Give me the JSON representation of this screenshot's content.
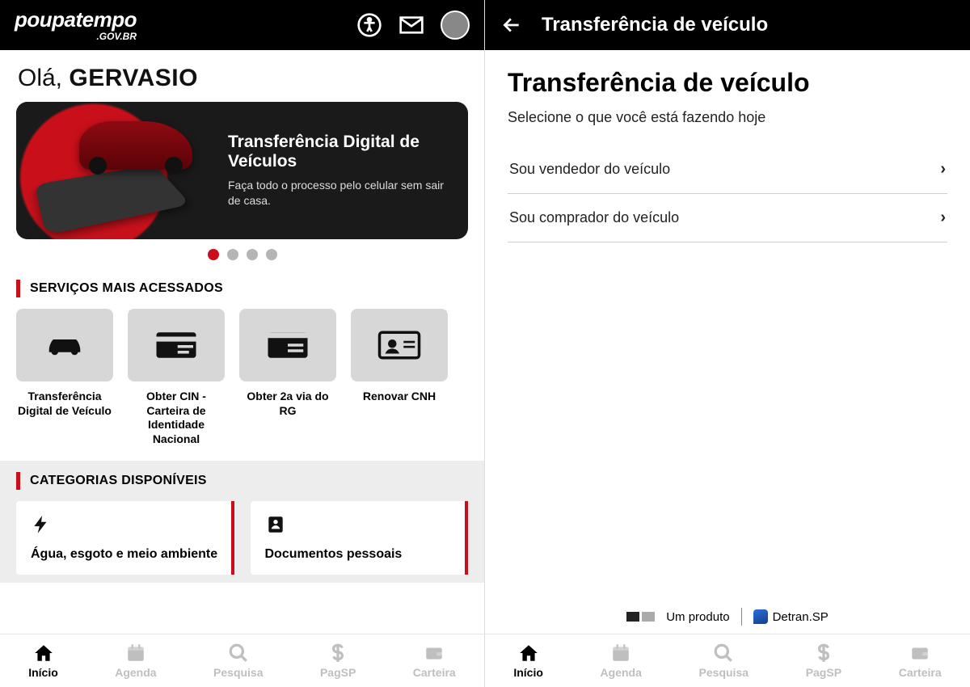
{
  "left": {
    "logo": {
      "main": "poupatempo",
      "sub": ".GOV.BR"
    },
    "greeting_prefix": "Olá, ",
    "user_name": "GERVASIO",
    "promo": {
      "title": "Transferência Digital de Veículos",
      "desc": "Faça todo o processo pelo celular sem sair de casa."
    },
    "carousel": {
      "count": 4,
      "active": 0
    },
    "section_services": "SERVIÇOS MAIS ACESSADOS",
    "services": [
      {
        "label": "Transferência Digital de Veículo",
        "icon": "car"
      },
      {
        "label": "Obter CIN - Carteira de Identidade Nacional",
        "icon": "id-card"
      },
      {
        "label": "Obter 2a via do RG",
        "icon": "id-card-alt"
      },
      {
        "label": "Renovar CNH",
        "icon": "license"
      }
    ],
    "section_categories": "CATEGORIAS DISPONÍVEIS",
    "categories": [
      {
        "label": "Água, esgoto e meio ambiente",
        "icon": "bolt"
      },
      {
        "label": "Documentos pessoais",
        "icon": "person-doc"
      }
    ]
  },
  "right": {
    "topbar_title": "Transferência de veículo",
    "heading": "Transferência de veículo",
    "subtitle": "Selecione o que você está fazendo hoje",
    "options": [
      "Sou vendedor do veículo",
      "Sou comprador do veículo"
    ],
    "footer_text": "Um produto",
    "detran_label": "Detran.SP"
  },
  "nav": [
    {
      "label": "Início",
      "icon": "home",
      "active": true
    },
    {
      "label": "Agenda",
      "icon": "calendar",
      "active": false
    },
    {
      "label": "Pesquisa",
      "icon": "search",
      "active": false
    },
    {
      "label": "PagSP",
      "icon": "dollar",
      "active": false
    },
    {
      "label": "Carteira",
      "icon": "wallet",
      "active": false
    }
  ]
}
